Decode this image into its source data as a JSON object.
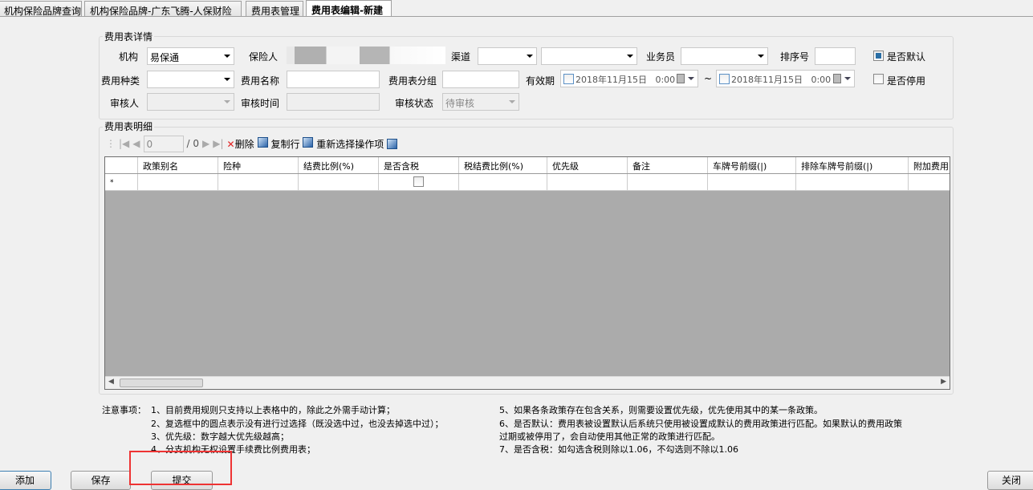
{
  "tabs": [
    "机构保险品牌查询",
    "机构保险品牌-广东飞腾-人保财险",
    "费用表管理",
    "费用表编辑-新建"
  ],
  "details": {
    "legend": "费用表详情",
    "org_label": "机构",
    "org_value": "易保通",
    "insurer_label": "保险人",
    "channel_label": "渠道",
    "salesman_label": "业务员",
    "sort_label": "排序号",
    "default_label": "是否默认",
    "default_checked": true,
    "fee_type_label": "费用种类",
    "fee_name_label": "费用名称",
    "group_label": "费用表分组",
    "validity_label": "有效期",
    "date_from": "2018年11月15日   0:00",
    "tilde": "~",
    "date_to": "2018年11月15日   0:00",
    "disabled_label": "是否停用",
    "disabled_checked": false,
    "reviewer_label": "审核人",
    "review_time_label": "审核时间",
    "review_status_label": "审核状态",
    "review_status_value": "待审核"
  },
  "detail_grid": {
    "legend": "费用表明细",
    "page_value": "0",
    "page_total": "/ 0",
    "delete": "删除",
    "copy_row": "复制行",
    "reselect": "重新选择操作项",
    "columns": [
      "政策别名",
      "险种",
      "结费比例(%)",
      "是否含税",
      "税结费比例(%)",
      "优先级",
      "备注",
      "车牌号前缀(|)",
      "排除车牌号前缀(|)",
      "附加费用"
    ],
    "new_row_marker": "*"
  },
  "notes": {
    "title": "注意事项：",
    "left": [
      "1、目前费用规则只支持以上表格中的，除此之外需手动计算；",
      "2、复选框中的圆点表示没有进行过选择（既没选中过，也没去掉选中过）；",
      "3、优先级：数字越大优先级越高；",
      "4、分支机构无权设置手续费比例费用表；"
    ],
    "right": [
      "5、如果各条政策存在包含关系，则需要设置优先级，优先使用其中的某一条政策。",
      "6、是否默认：费用表被设置默认后系统只使用被设置成默认的费用政策进行匹配。如果默认的费用政策",
      "过期或被停用了，会自动使用其他正常的政策进行匹配。",
      "7、是否含税：如勾选含税则除以1.06，不勾选则不除以1.06"
    ]
  },
  "buttons": {
    "add": "添加",
    "save": "保存",
    "submit": "提交",
    "close": "关闭"
  },
  "highlight_color": "#ee3333"
}
